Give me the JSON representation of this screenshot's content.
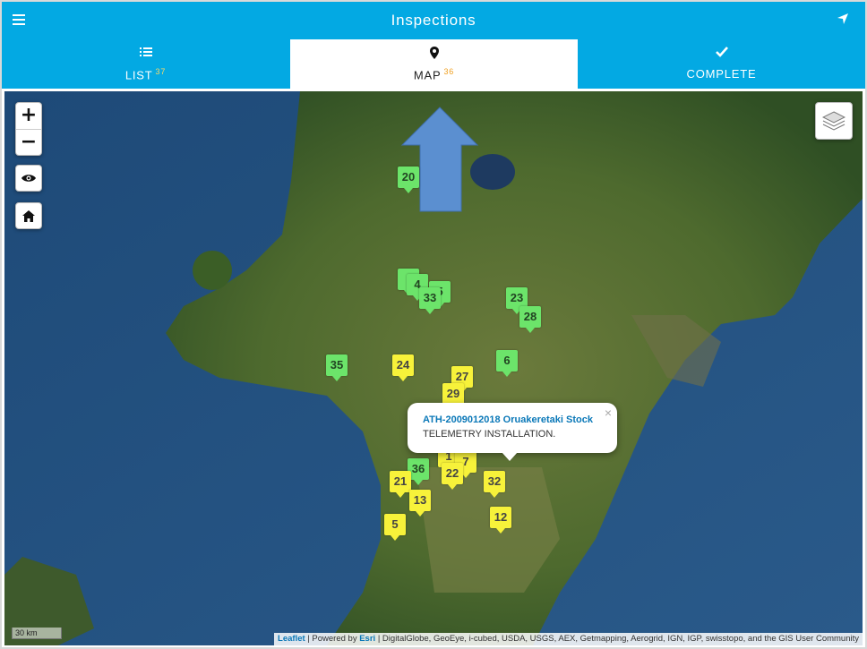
{
  "header": {
    "title": "Inspections",
    "menu_icon": "menu-icon",
    "locate_icon": "navigation-arrow-icon",
    "accent": "#03a9e3"
  },
  "tabs": [
    {
      "label": "LIST",
      "count": "37",
      "icon": "list-icon"
    },
    {
      "label": "MAP",
      "count": "36",
      "icon": "map-pin-icon"
    },
    {
      "label": "COMPLETE",
      "count": "",
      "icon": "checkmark-icon"
    }
  ],
  "map": {
    "zoom_in": "+",
    "zoom_out": "−",
    "markers": [
      {
        "label": "20",
        "status": "green"
      },
      {
        "label": "4",
        "status": "green"
      },
      {
        "label": "5",
        "status": "green"
      },
      {
        "label": "33",
        "status": "green"
      },
      {
        "label": "23",
        "status": "green"
      },
      {
        "label": "28",
        "status": "green"
      },
      {
        "label": "35",
        "status": "green"
      },
      {
        "label": "24",
        "status": "yellow"
      },
      {
        "label": "6",
        "status": "green"
      },
      {
        "label": "27",
        "status": "yellow"
      },
      {
        "label": "29",
        "status": "yellow"
      },
      {
        "label": "1",
        "status": "yellow"
      },
      {
        "label": "7",
        "status": "yellow"
      },
      {
        "label": "36",
        "status": "green"
      },
      {
        "label": "22",
        "status": "yellow"
      },
      {
        "label": "21",
        "status": "yellow"
      },
      {
        "label": "32",
        "status": "yellow"
      },
      {
        "label": "13",
        "status": "yellow"
      },
      {
        "label": "12",
        "status": "yellow"
      },
      {
        "label": "5",
        "status": "yellow"
      }
    ],
    "popup": {
      "title": "ATH-2009012018 Oruakeretaki Stock",
      "text": "TELEMETRY INSTALLATION.",
      "close": "×"
    },
    "scale": "30 km",
    "attribution": {
      "leaflet": "Leaflet",
      "powered": "| Powered by",
      "esri": "Esri",
      "sources": "| DigitalGlobe, GeoEye, i-cubed, USDA, USGS, AEX, Getmapping, Aerogrid, IGN, IGP, swisstopo, and the GIS User Community"
    }
  }
}
